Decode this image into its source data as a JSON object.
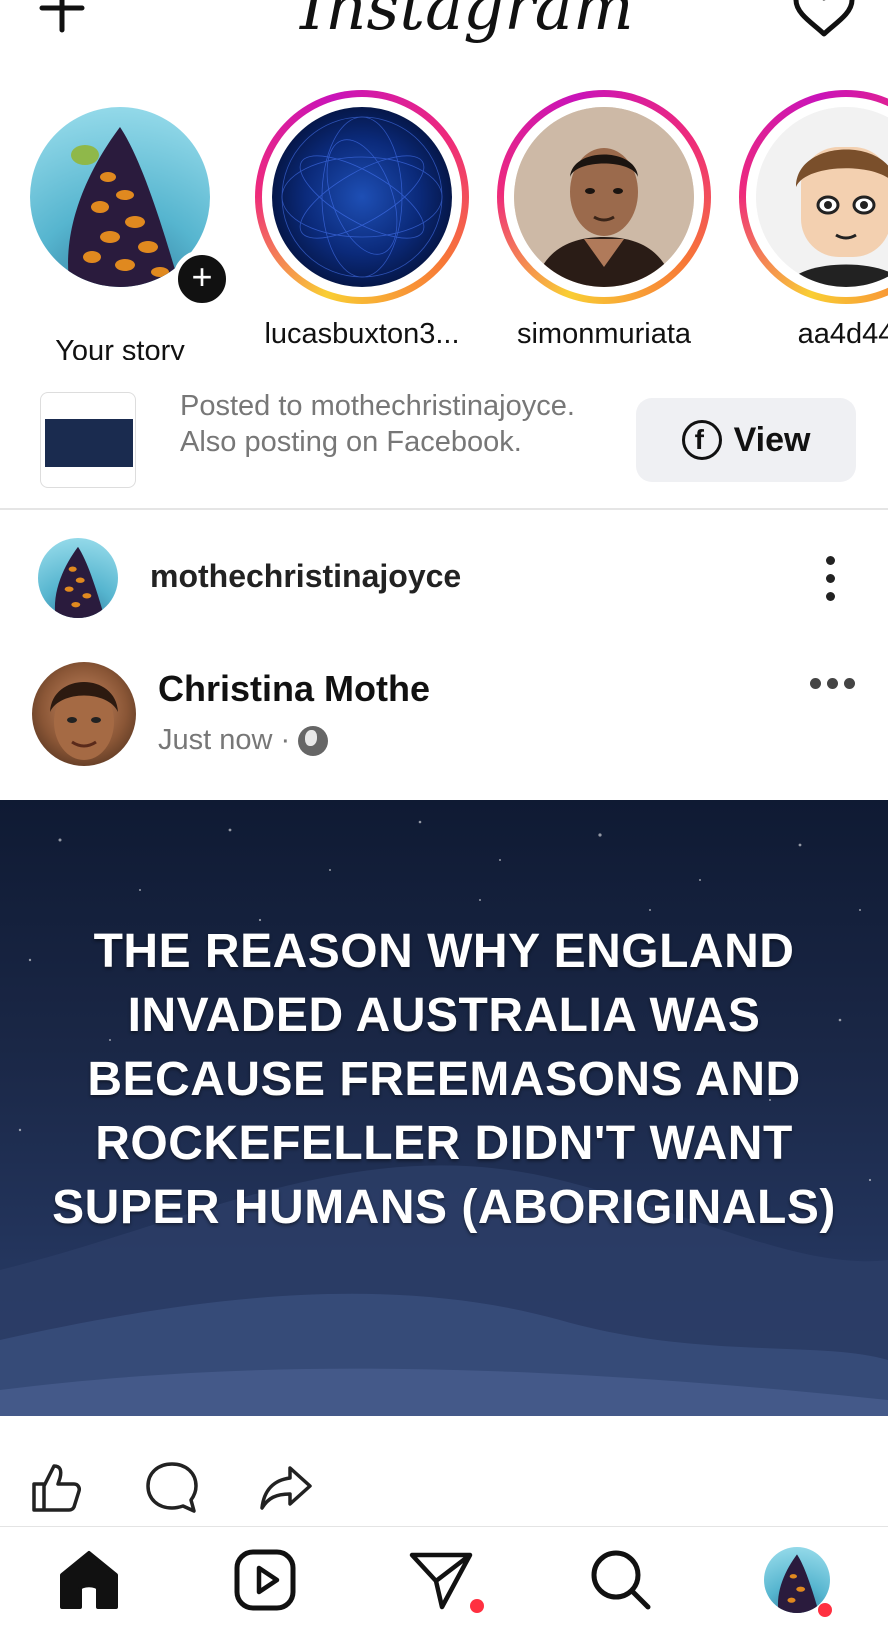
{
  "header": {
    "logo_text": "Instagram",
    "new_post_icon": "plus-icon",
    "activity_icon": "heart-icon"
  },
  "stories": [
    {
      "label": "Your story",
      "own": true
    },
    {
      "label": "lucasbuxton3..."
    },
    {
      "label": "simonmuriata"
    },
    {
      "label": "aa4d44"
    }
  ],
  "crosspost": {
    "text": "Posted to mothechristinajoyce. Also posting on Facebook.",
    "button_label": "View",
    "button_icon": "facebook-icon"
  },
  "post": {
    "username": "mothechristinajoyce",
    "author_name": "Christina Mothe",
    "time": "Just now",
    "separator": "·",
    "audience_icon": "globe-icon",
    "caption": "THE REASON WHY ENGLAND INVADED AUSTRALIA WAS BECAUSE FREEMASONS AND ROCKEFELLER DIDN'T WANT SUPER HUMANS (ABORIGINALS)"
  },
  "actions": [
    "like-icon",
    "comment-icon",
    "share-icon"
  ],
  "bottom_nav": [
    "home-icon",
    "reels-icon",
    "messages-icon",
    "search-icon",
    "profile-avatar"
  ],
  "colors": {
    "notification_dot": "#ff3040",
    "view_button_bg": "#eff0f3",
    "muted_text": "#777777"
  }
}
